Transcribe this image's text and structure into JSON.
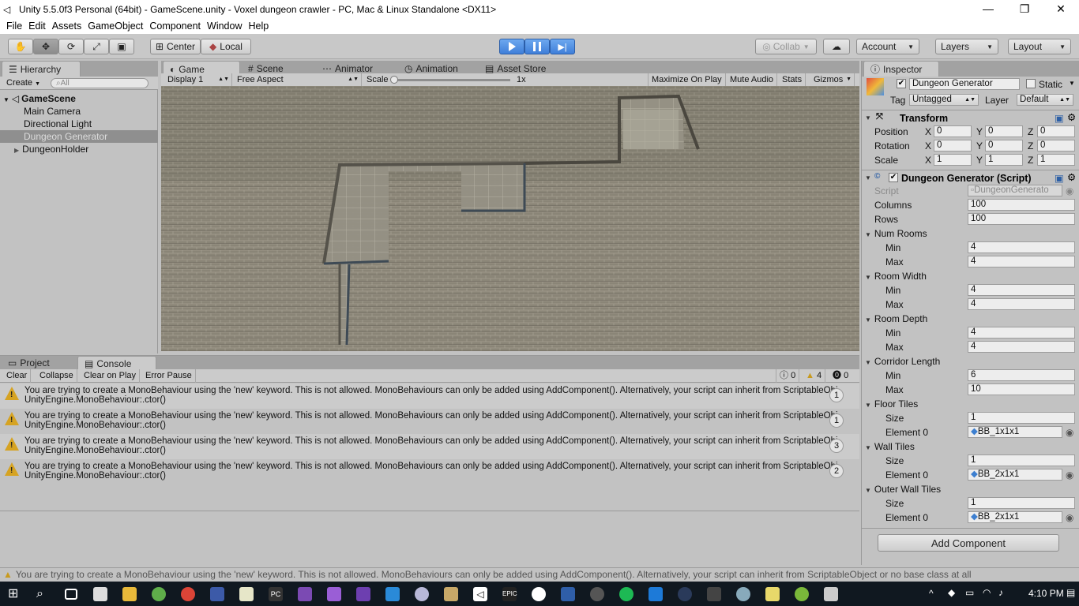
{
  "window": {
    "title": "Unity 5.5.0f3 Personal (64bit) - GameScene.unity - Voxel dungeon crawler - PC, Mac & Linux Standalone <DX11>"
  },
  "menu": [
    "File",
    "Edit",
    "Assets",
    "GameObject",
    "Component",
    "Window",
    "Help"
  ],
  "toolbar": {
    "pivot": "Center",
    "space": "Local",
    "collab": "Collab",
    "account": "Account",
    "layers": "Layers",
    "layout": "Layout"
  },
  "hierarchy": {
    "tab": "Hierarchy",
    "create": "Create",
    "search_placeholder": "All",
    "scene": "GameScene",
    "items": [
      "Main Camera",
      "Directional Light",
      "Dungeon Generator",
      "DungeonHolder"
    ]
  },
  "tabs": [
    "Game",
    "Scene",
    "Animator",
    "Animation",
    "Asset Store"
  ],
  "game": {
    "display": "Display 1",
    "aspect": "Free Aspect",
    "scale_label": "Scale",
    "scale_value": "1x",
    "maximize": "Maximize On Play",
    "mute": "Mute Audio",
    "stats": "Stats",
    "gizmos": "Gizmos"
  },
  "console": {
    "tabs": [
      "Project",
      "Console"
    ],
    "buttons": [
      "Clear",
      "Collapse",
      "Clear on Play",
      "Error Pause"
    ],
    "counts": {
      "log": "0",
      "warn": "4",
      "error": "0"
    },
    "entries": [
      {
        "line1": "You are trying to create a MonoBehaviour using the 'new' keyword.  This is not allowed.  MonoBehaviours can only be added using AddComponent().  Alternatively, your script can inherit from ScriptableObject or no base class at all",
        "line2": "UnityEngine.MonoBehaviour:.ctor()",
        "count": "1"
      },
      {
        "line1": "You are trying to create a MonoBehaviour using the 'new' keyword.  This is not allowed.  MonoBehaviours can only be added using AddComponent().  Alternatively, your script can inherit from ScriptableObject or no base class at all",
        "line2": "UnityEngine.MonoBehaviour:.ctor()",
        "count": "1"
      },
      {
        "line1": "You are trying to create a MonoBehaviour using the 'new' keyword.  This is not allowed.  MonoBehaviours can only be added using AddComponent().  Alternatively, your script can inherit from ScriptableObject or no base class at all",
        "line2": "UnityEngine.MonoBehaviour:.ctor()",
        "count": "3"
      },
      {
        "line1": "You are trying to create a MonoBehaviour using the 'new' keyword.  This is not allowed.  MonoBehaviours can only be added using AddComponent().  Alternatively, your script can inherit from ScriptableObject or no base class at all",
        "line2": "UnityEngine.MonoBehaviour:.ctor()",
        "count": "2"
      }
    ]
  },
  "inspector": {
    "tab": "Inspector",
    "object_name": "Dungeon Generator",
    "static_label": "Static",
    "tag_label": "Tag",
    "tag": "Untagged",
    "layer_label": "Layer",
    "layer": "Default",
    "transform": {
      "title": "Transform",
      "position_label": "Position",
      "rotation_label": "Rotation",
      "scale_label": "Scale",
      "position": [
        "0",
        "0",
        "0"
      ],
      "rotation": [
        "0",
        "0",
        "0"
      ],
      "scale": [
        "1",
        "1",
        "1"
      ],
      "axes": [
        "X",
        "Y",
        "Z"
      ]
    },
    "script": {
      "title": "Dungeon Generator (Script)",
      "script_label": "Script",
      "script_value": "DungeonGenerato",
      "columns_label": "Columns",
      "columns": "100",
      "rows_label": "Rows",
      "rows": "100",
      "num_rooms": "Num Rooms",
      "room_width": "Room Width",
      "room_depth": "Room Depth",
      "corridor_length": "Corridor Length",
      "min_label": "Min",
      "max_label": "Max",
      "num_rooms_min": "4",
      "num_rooms_max": "4",
      "room_width_min": "4",
      "room_width_max": "4",
      "room_depth_min": "4",
      "room_depth_max": "4",
      "corridor_min": "6",
      "corridor_max": "10",
      "floor_tiles": "Floor Tiles",
      "wall_tiles": "Wall Tiles",
      "outer_wall_tiles": "Outer Wall Tiles",
      "size_label": "Size",
      "element_label": "Element 0",
      "floor_size": "1",
      "floor_el": "BB_1x1x1",
      "wall_size": "1",
      "wall_el": "BB_2x1x1",
      "outer_size": "1",
      "outer_el": "BB_2x1x1"
    },
    "add_component": "Add Component"
  },
  "statusbar": "You are trying to create a MonoBehaviour using the 'new' keyword.  This is not allowed.  MonoBehaviours can only be added using AddComponent().  Alternatively, your script can inherit from ScriptableObject or no base class at all",
  "taskbar": {
    "time": "4:10 PM"
  }
}
